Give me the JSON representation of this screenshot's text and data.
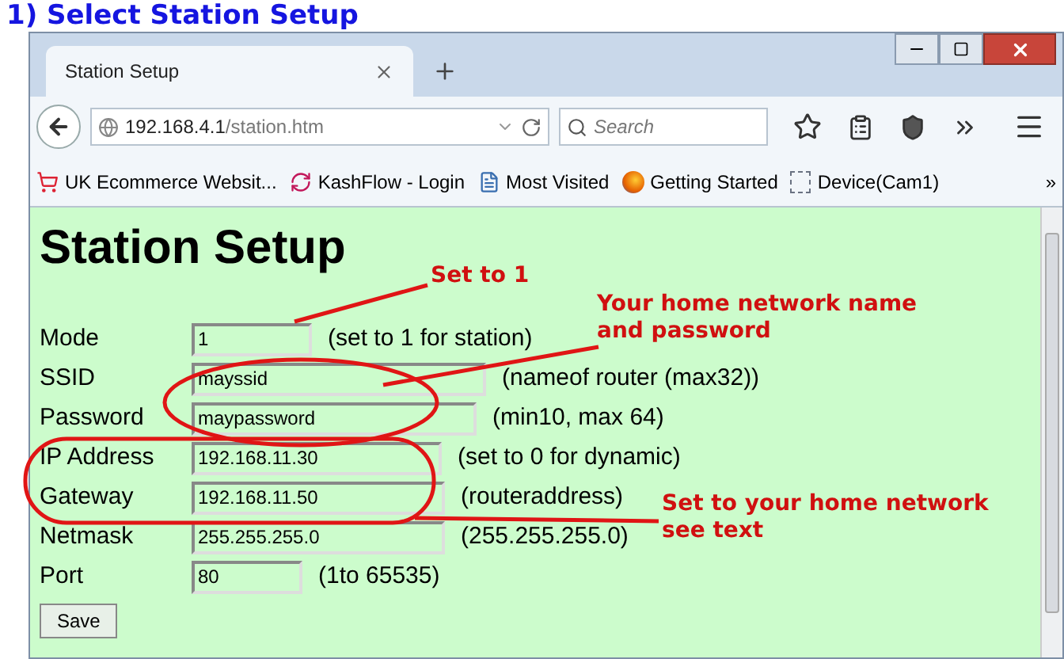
{
  "page_heading": "1) Select Station Setup",
  "tabs": [
    {
      "label": "Station Setup",
      "selected": true
    }
  ],
  "address_bar": {
    "host": "192.168.4.1",
    "path": "/station.htm"
  },
  "search": {
    "placeholder": "Search"
  },
  "bookmarks": [
    {
      "label": "UK Ecommerce Websit...",
      "kind": "cart"
    },
    {
      "label": "KashFlow - Login",
      "kind": "swirl"
    },
    {
      "label": "Most Visited",
      "kind": "page"
    },
    {
      "label": "Getting Started",
      "kind": "firefox"
    },
    {
      "label": "Device(Cam1)",
      "kind": "blank"
    }
  ],
  "bookmarks_more": "»",
  "content": {
    "heading": "Station Setup",
    "fields": [
      {
        "label": "Mode",
        "value": "1",
        "hint": "(set to 1 for station)"
      },
      {
        "label": "SSID",
        "value": "mayssid",
        "hint": "(nameof router (max32))"
      },
      {
        "label": "Password",
        "value": "maypassword",
        "hint": "(min10, max 64)"
      },
      {
        "label": "IP Address",
        "value": "192.168.11.30",
        "hint": "(set to 0 for dynamic)"
      },
      {
        "label": "Gateway",
        "value": "192.168.11.50",
        "hint": "(routeraddress)"
      },
      {
        "label": "Netmask",
        "value": "255.255.255.0",
        "hint": "(255.255.255.0)"
      },
      {
        "label": "Port",
        "value": "80",
        "hint": "(1to 65535)"
      }
    ],
    "save_button": "Save"
  },
  "annotations": [
    {
      "lines": [
        "Set to 1"
      ]
    },
    {
      "lines": [
        "Your home network name",
        "and password"
      ]
    },
    {
      "lines": [
        "Set to your home network",
        "see text"
      ]
    }
  ]
}
